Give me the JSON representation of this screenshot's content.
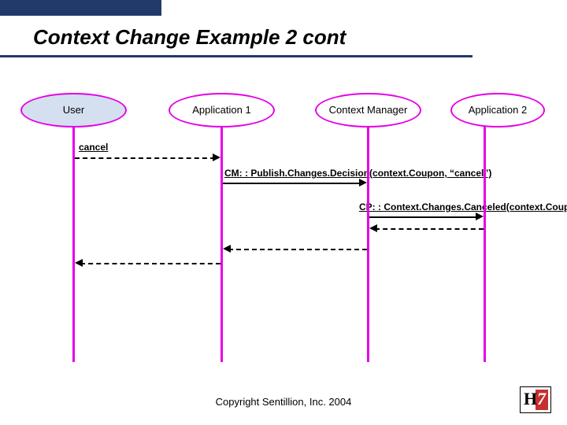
{
  "title": "Context Change Example 2 cont",
  "actors": {
    "user": "User",
    "app1": "Application 1",
    "cm": "Context Manager",
    "app2": "Application 2"
  },
  "messages": {
    "cancel": "cancel",
    "publish": "CM: : Publish.Changes.Decision(context.Coupon, “cancel”)",
    "canceled": "CP: : Context.Changes.Canceled(context.Coupon)"
  },
  "copyright": "Copyright Sentillion, Inc. 2004",
  "chart_data": {
    "type": "sequence-diagram",
    "participants": [
      "User",
      "Application 1",
      "Context Manager",
      "Application 2"
    ],
    "messages": [
      {
        "from": "User",
        "to": "Application 1",
        "label": "cancel",
        "style": "dashed",
        "direction": "right"
      },
      {
        "from": "Application 1",
        "to": "Context Manager",
        "label": "CM::Publish.Changes.Decision(context.Coupon, \"cancel\")",
        "style": "solid",
        "direction": "right"
      },
      {
        "from": "Context Manager",
        "to": "Application 2",
        "label": "CP::Context.Changes.Canceled(context.Coupon)",
        "style": "solid",
        "direction": "right"
      },
      {
        "from": "Application 2",
        "to": "Context Manager",
        "label": "",
        "style": "dashed",
        "direction": "left"
      },
      {
        "from": "Context Manager",
        "to": "Application 1",
        "label": "",
        "style": "dashed",
        "direction": "left"
      },
      {
        "from": "Application 1",
        "to": "User",
        "label": "",
        "style": "dashed",
        "direction": "left"
      }
    ]
  }
}
